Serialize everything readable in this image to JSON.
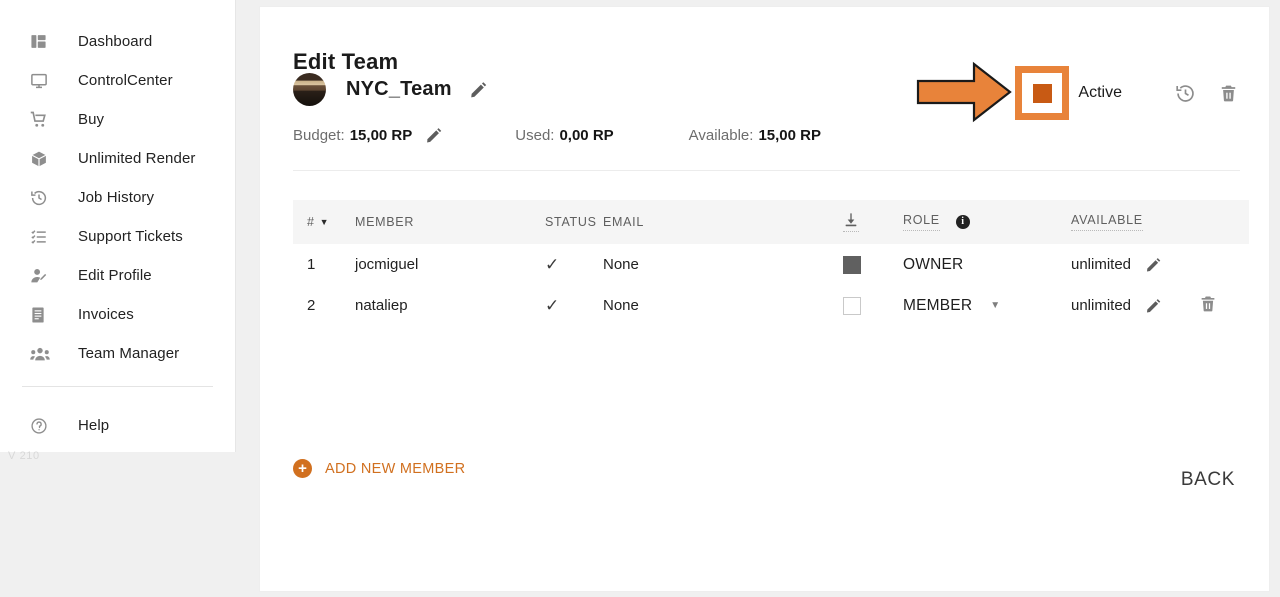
{
  "sidebar": {
    "items": [
      {
        "label": "Dashboard",
        "icon": "dashboard-icon"
      },
      {
        "label": "ControlCenter",
        "icon": "monitor-icon"
      },
      {
        "label": "Buy",
        "icon": "cart-icon"
      },
      {
        "label": "Unlimited Render",
        "icon": "box-icon"
      },
      {
        "label": "Job History",
        "icon": "history-icon"
      },
      {
        "label": "Support Tickets",
        "icon": "checklist-icon"
      },
      {
        "label": "Edit Profile",
        "icon": "user-edit-icon"
      },
      {
        "label": "Invoices",
        "icon": "invoice-icon"
      },
      {
        "label": "Team Manager",
        "icon": "team-icon"
      }
    ],
    "help": {
      "label": "Help",
      "icon": "question-circle-icon"
    },
    "version": "V 210"
  },
  "header": {
    "title": "Edit Team",
    "team_name": "NYC_Team",
    "stats": {
      "budget_label": "Budget:",
      "budget_value": "15,00 RP",
      "used_label": "Used:",
      "used_value": "0,00 RP",
      "available_label": "Available:",
      "available_value": "15,00 RP"
    },
    "active_label": "Active",
    "active_checked": true
  },
  "table": {
    "columns": {
      "num": "#",
      "member": "MEMBER",
      "status": "STATUS",
      "email": "EMAIL",
      "download": "download-icon",
      "role": "ROLE",
      "available": "AVAILABLE"
    },
    "rows": [
      {
        "num": "1",
        "member": "jocmiguel",
        "status": "✓",
        "email": "None",
        "checkbox": "filled",
        "role": "OWNER",
        "role_dropdown": false,
        "available": "unlimited",
        "deletable": false
      },
      {
        "num": "2",
        "member": "nataliep",
        "status": "✓",
        "email": "None",
        "checkbox": "empty",
        "role": "MEMBER",
        "role_dropdown": true,
        "available": "unlimited",
        "deletable": true
      }
    ]
  },
  "footer": {
    "add_member_label": "ADD NEW MEMBER",
    "back_label": "BACK"
  },
  "colors": {
    "accent_orange": "#d1701f",
    "annotation_orange": "#e8833a",
    "checkbox_orange": "#c85a14",
    "text_dark": "#1b1b1b",
    "text_muted": "#6d6d6d"
  }
}
